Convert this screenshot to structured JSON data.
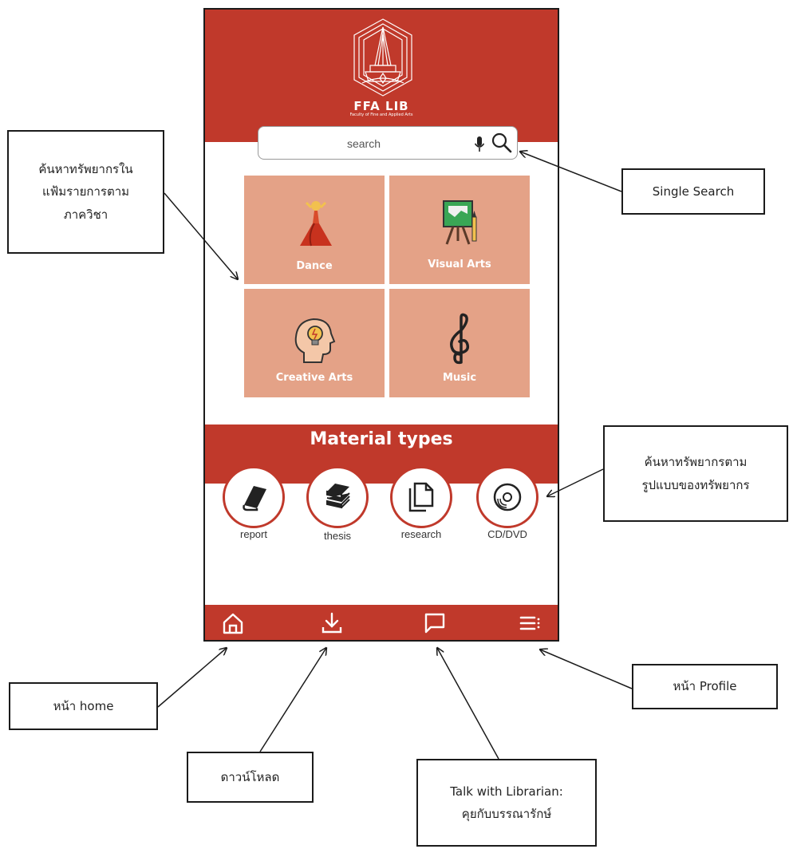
{
  "app": {
    "title": "FFA LIB",
    "subtitle": "Faculty of Fine and Applied Arts",
    "brand_color": "#c0392b",
    "tile_color": "#e4a287"
  },
  "search": {
    "placeholder": "search",
    "icons": [
      "microphone-icon",
      "search-icon"
    ]
  },
  "categories": [
    {
      "label": "Dance",
      "icon": "dancer-icon"
    },
    {
      "label": "Visual Arts",
      "icon": "easel-icon"
    },
    {
      "label": "Creative Arts",
      "icon": "head-lightbulb-icon"
    },
    {
      "label": "Music",
      "icon": "treble-clef-icon"
    }
  ],
  "material_types": {
    "title": "Material types",
    "items": [
      {
        "label": "report",
        "icon": "book-icon"
      },
      {
        "label": "thesis",
        "icon": "books-stack-icon"
      },
      {
        "label": "research",
        "icon": "documents-icon"
      },
      {
        "label": "CD/DVD",
        "icon": "disc-icon"
      }
    ]
  },
  "bottom_nav": [
    {
      "icon": "home-icon"
    },
    {
      "icon": "download-icon"
    },
    {
      "icon": "chat-icon"
    },
    {
      "icon": "menu-icon"
    }
  ],
  "annotations": {
    "categories_lines": [
      "ค้นหาทรัพยากรใน",
      "แฟ้มรายการตาม",
      "ภาควิชา"
    ],
    "single_search": "Single Search",
    "material_lines": [
      "ค้นหาทรัพยากรตาม",
      "รูปแบบของทรัพยากร"
    ],
    "home": "หน้า home",
    "download": "ดาวน์โหลด",
    "talk_lines": [
      "Talk with Librarian:",
      "คุยกับบรรณารักษ์"
    ],
    "profile": "หน้า Profile"
  }
}
